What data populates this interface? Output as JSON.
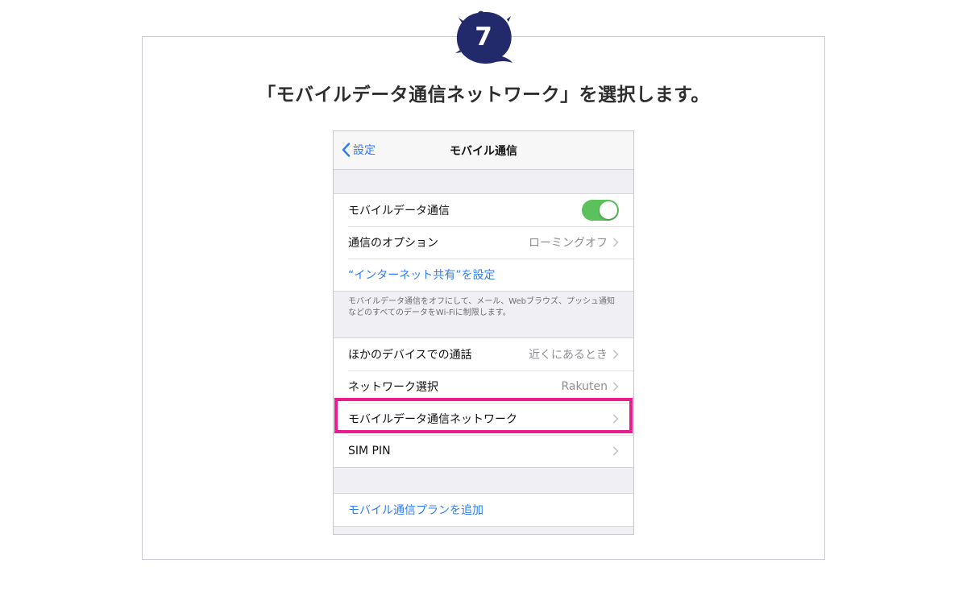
{
  "step": {
    "number": "7",
    "badge_color": "#232a6b"
  },
  "instruction": "「モバイルデータ通信ネットワーク」を選択します。",
  "phone": {
    "navbar": {
      "back_label": "設定",
      "title": "モバイル通信"
    },
    "group1": {
      "mobile_data": {
        "label": "モバイルデータ通信",
        "toggle_on": true
      },
      "options": {
        "label": "通信のオプション",
        "value": "ローミングオフ"
      },
      "hotspot_link": "“インターネット共有”を設定"
    },
    "footnote": "モバイルデータ通信をオフにして、メール、Webブラウズ、プッシュ通知などのすべてのデータをWi-Fiに制限します。",
    "group2": {
      "other_devices": {
        "label": "ほかのデバイスでの通話",
        "value": "近くにあるとき"
      },
      "network_select": {
        "label": "ネットワーク選択",
        "value": "Rakuten"
      },
      "mobile_data_network": {
        "label": "モバイルデータ通信ネットワーク"
      },
      "sim_pin": {
        "label": "SIM PIN"
      }
    },
    "group3": {
      "add_plan": "モバイル通信プランを追加"
    }
  },
  "colors": {
    "accent_blue": "#2f7cf6",
    "toggle_green": "#5ac15c",
    "highlight_pink": "#ec1c8e"
  }
}
